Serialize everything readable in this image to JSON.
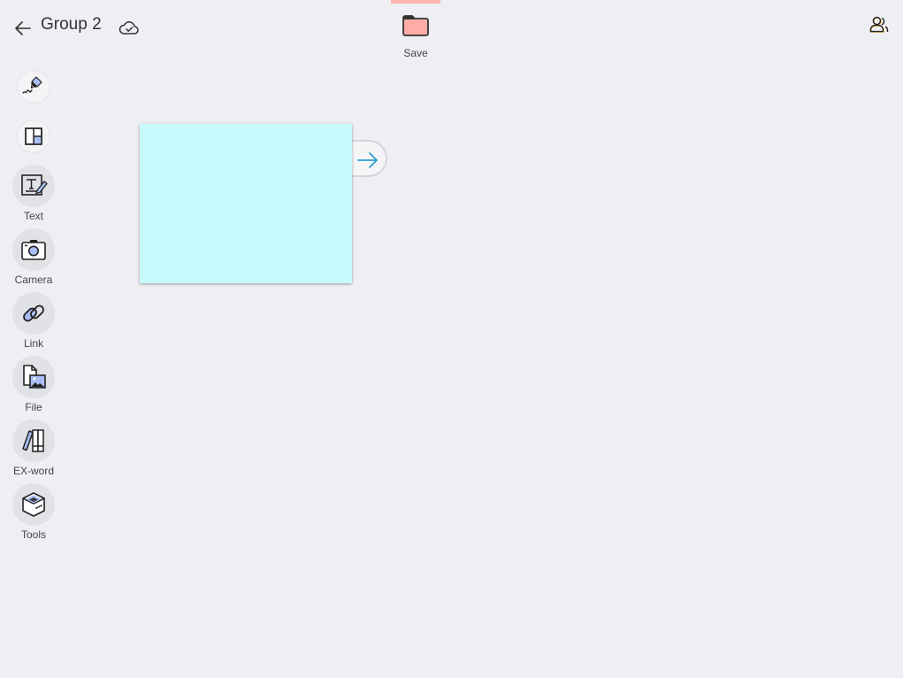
{
  "header": {
    "title": "Group 2",
    "save_label": "Save",
    "sync_status": "saved-to-cloud"
  },
  "sidebar": {
    "items": [
      {
        "id": "pen",
        "label": "",
        "icon": "pen-icon"
      },
      {
        "id": "layout",
        "label": "",
        "icon": "layout-icon"
      },
      {
        "id": "text",
        "label": "Text",
        "icon": "text-edit-icon"
      },
      {
        "id": "camera",
        "label": "Camera",
        "icon": "camera-icon"
      },
      {
        "id": "link",
        "label": "Link",
        "icon": "link-icon"
      },
      {
        "id": "file",
        "label": "File",
        "icon": "file-image-icon"
      },
      {
        "id": "exword",
        "label": "EX-word",
        "icon": "books-icon"
      },
      {
        "id": "tools",
        "label": "Tools",
        "icon": "toolbox-icon"
      }
    ]
  },
  "canvas": {
    "cards": [
      {
        "color": "#c6fafc",
        "text": ""
      }
    ]
  },
  "colors": {
    "background": "#eeeff3",
    "accent_save": "#ffb3ad",
    "accent_blue": "#a9bdf5",
    "arrow": "#2e9ccb"
  }
}
